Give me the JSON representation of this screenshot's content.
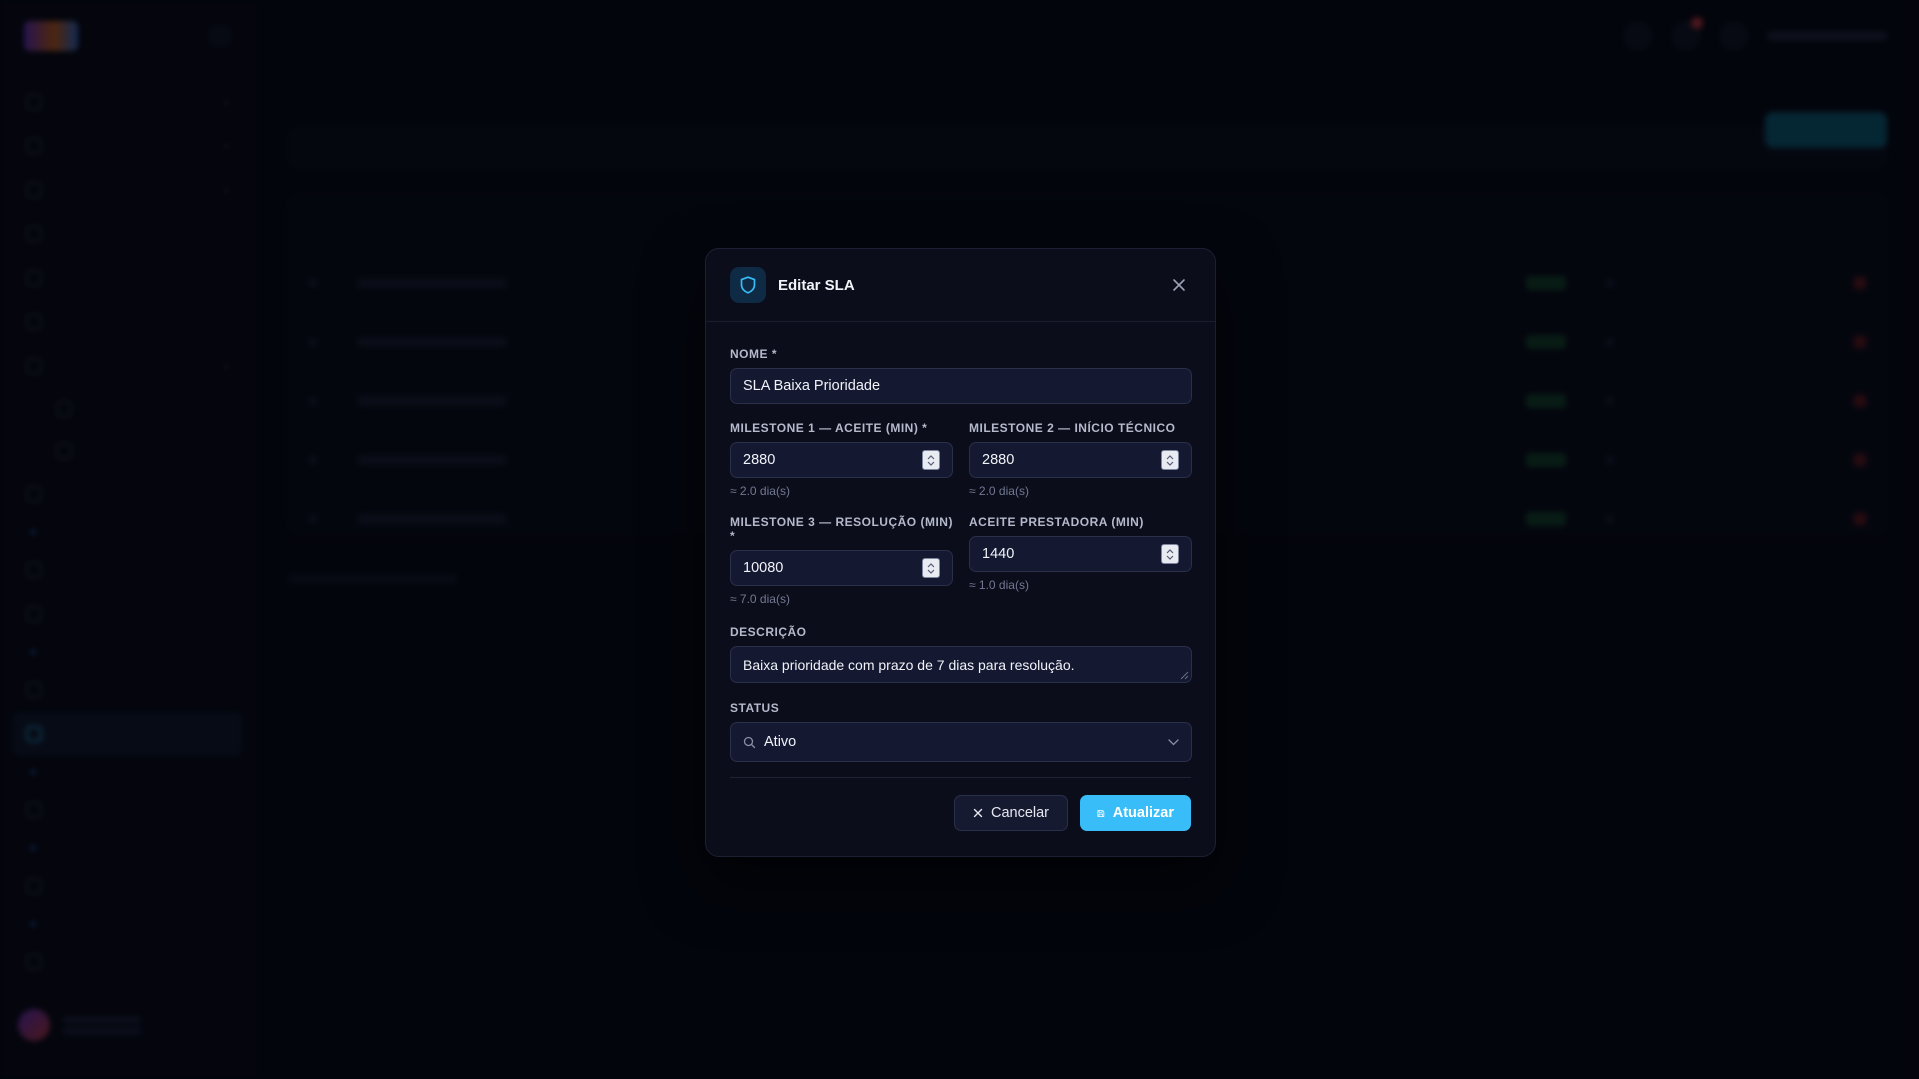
{
  "modal": {
    "title": "Editar SLA",
    "fields": {
      "nome": {
        "label": "NOME *",
        "value": "SLA Baixa Prioridade"
      },
      "milestone1": {
        "label": "MILESTONE 1 — ACEITE (MIN) *",
        "value": "2880",
        "hint": "≈ 2.0 dia(s)"
      },
      "milestone2": {
        "label": "MILESTONE 2 — INÍCIO TÉCNICO",
        "value": "2880",
        "hint": "≈ 2.0 dia(s)"
      },
      "milestone3": {
        "label": "MILESTONE 3 — RESOLUÇÃO (MIN) *",
        "value": "10080",
        "hint": "≈ 7.0 dia(s)"
      },
      "aceite_prestadora": {
        "label": "ACEITE PRESTADORA (MIN)",
        "value": "1440",
        "hint": "≈ 1.0 dia(s)"
      },
      "descricao": {
        "label": "DESCRIÇÃO",
        "value": "Baixa prioridade com prazo de 7 dias para resolução."
      },
      "status": {
        "label": "STATUS",
        "value": "Ativo"
      }
    },
    "buttons": {
      "cancel": "Cancelar",
      "save": "Atualizar"
    }
  },
  "colors": {
    "accent": "#38bdf8",
    "modal_bg": "#0b0d1a",
    "input_bg": "#141830",
    "page_bg": "#05060d"
  },
  "icons": {
    "header": "shield-icon",
    "close": "close-icon",
    "stepper": "stepper-arrows-icon",
    "status_search": "search-icon",
    "status_dropdown": "chevron-down-icon",
    "cancel": "x-icon",
    "save": "save-icon"
  }
}
